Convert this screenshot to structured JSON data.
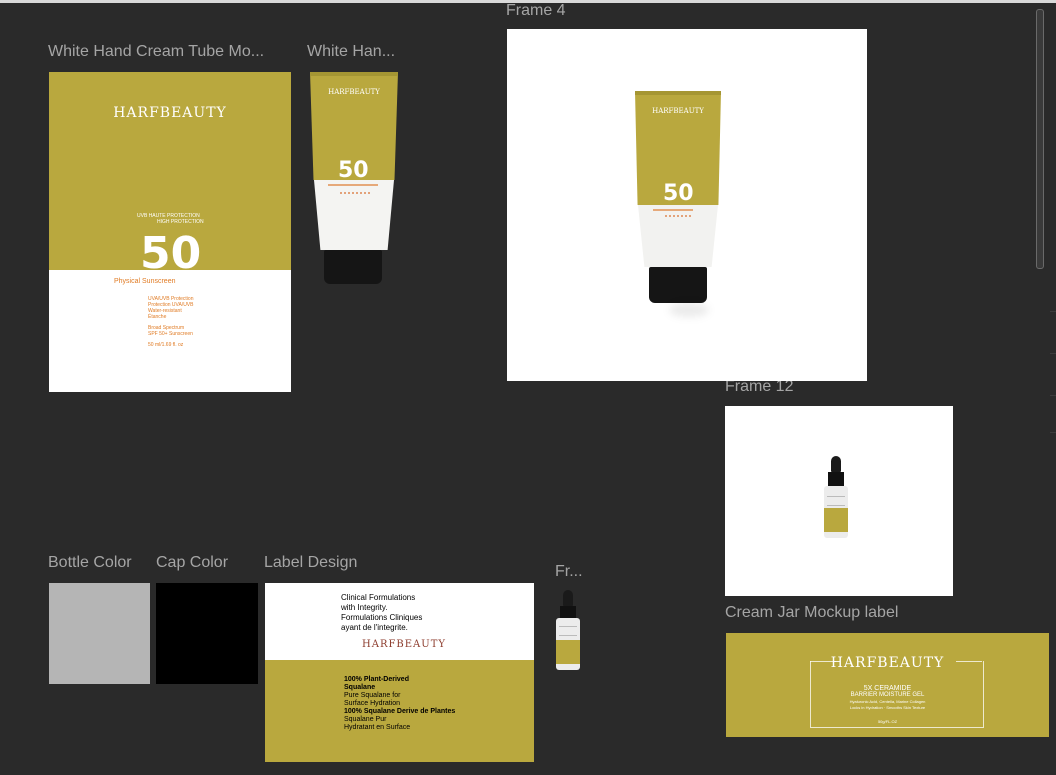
{
  "frames": {
    "tube_mockup_title": "White Hand Cream Tube Mo...",
    "tube_small_title": "White Han...",
    "frame4_title": "Frame 4",
    "frame12_title": "Frame 12",
    "bottle_color_title": "Bottle Color",
    "cap_color_title": "Cap Color",
    "label_design_title": "Label Design",
    "fr_title": "Fr...",
    "cream_jar_title": "Cream Jar Mockup label"
  },
  "tube_label": {
    "brand": "HARFBEAUTY",
    "uvb_line1": "UVB   HAUTE PROTECTION",
    "uvb_line2": "HIGH PROTECTION",
    "spf": "50",
    "subtitle": "Physical Sunscreen",
    "feat1": "UVA/UVB Protection",
    "feat2": "Protection UVA/UVB",
    "feat3": "Water-resistant",
    "feat4": "Étanche",
    "feat5": "Broad Spectrum",
    "feat6": "SPF 50+ Sunscreen",
    "volume": "50 ml/1.69 fl. oz"
  },
  "label_design": {
    "tag1": "Clinical Formulations",
    "tag2": "with Integrity.",
    "tag3": "Formulations Cliniques",
    "tag4": "ayant de l'integrite.",
    "brand": "HARFBEAUTY",
    "l1": "100% Plant-Derived",
    "l2": "Squalane",
    "l3": "Pure Squalane for",
    "l4": "Surface Hydration",
    "l5": "100% Squalane Derive de Plantes",
    "l6": "Squalane Pur",
    "l7": "Hydratant en Surface"
  },
  "cream_jar": {
    "brand": "HARFBEAUTY",
    "line1": "5X CERAMIDE",
    "line2": "BARRIER MOISTURE GEL",
    "line3": "Hyaluronic Acid, Centella, Marine Collagen",
    "line4": "Locks in Hydration · Smooths Skin Texture",
    "weight": "50g/FL.OZ"
  },
  "colors": {
    "canvas": "#2a2a2a",
    "olive": "#b9a83e",
    "bottle": "#b5b5b5",
    "cap": "#000000",
    "accent_orange": "#e07b24"
  }
}
